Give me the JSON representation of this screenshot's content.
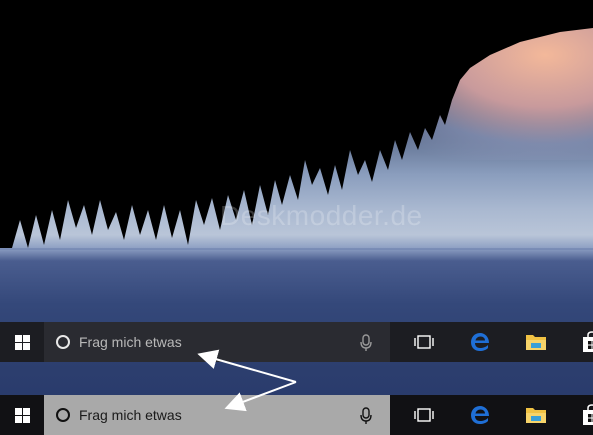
{
  "watermark": "Deskmodder.de",
  "taskbar_top": {
    "search_placeholder": "Frag mich etwas"
  },
  "taskbar_bottom": {
    "search_placeholder": "Frag mich etwas"
  },
  "icons": {
    "start": "windows-logo",
    "cortana": "circle-ring",
    "mic": "microphone",
    "task_view": "task-view",
    "edge": "edge-browser",
    "explorer": "file-explorer-folder",
    "store": "windows-store-bag"
  },
  "colors": {
    "taskbar_top_bg": "#1c1d22",
    "search_dark_bg": "#2a2b31",
    "taskbar_bottom_bg": "#111114",
    "search_light_bg": "#a9a9a9",
    "edge_blue": "#1f6fd6",
    "folder_yellow": "#f0c244",
    "arrow": "#ffffff"
  }
}
